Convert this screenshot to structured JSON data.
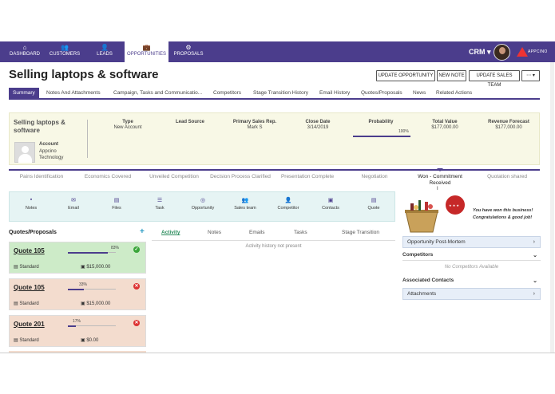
{
  "nav": {
    "items": [
      {
        "icon": "home-icon",
        "glyph": "⌂",
        "label": "DASHBOARD"
      },
      {
        "icon": "customers-icon",
        "glyph": "👥",
        "label": "CUSTOMERS"
      },
      {
        "icon": "leads-icon",
        "glyph": "👤",
        "label": "LEADS"
      },
      {
        "icon": "briefcase-icon",
        "glyph": "💼",
        "label": "OPPORTUNITIES"
      },
      {
        "icon": "proposals-icon",
        "glyph": "⚙",
        "label": "PROPOSALS"
      }
    ],
    "app_switcher": "CRM ▾",
    "logo_text": "APPCINO"
  },
  "page": {
    "title": "Selling laptops & software",
    "buttons": [
      "UPDATE OPPORTUNITY",
      "NEW NOTE",
      "UPDATE SALES TEAM",
      "⋯ ▾"
    ]
  },
  "tabs": [
    "Summary",
    "Notes And Attachments",
    "Campaign, Tasks and Communicatio...",
    "Competitors",
    "Stage Transition History",
    "Email History",
    "Quotes/Proposals",
    "News",
    "Related Actions"
  ],
  "summary": {
    "title": "Selling laptops & software",
    "account_label": "Account",
    "account_name": "Appcino Technology",
    "fields": [
      {
        "label": "Type",
        "value": "New Account"
      },
      {
        "label": "Lead Source",
        "value": ""
      },
      {
        "label": "Primary Sales Rep.",
        "value": "Mark S"
      },
      {
        "label": "Close Date",
        "value": "3/14/2019"
      },
      {
        "label": "Probability",
        "value": ""
      },
      {
        "label": "Total Value",
        "value": "$177,000.00"
      },
      {
        "label": "Revenue Forecast",
        "value": "$177,000.00"
      }
    ],
    "probability_pct": "100%",
    "probability": 1.0
  },
  "stages": [
    "Pains Identification",
    "Economics Covered",
    "Unveiled Competition",
    "Decision Process Clarified",
    "Presentation Complete",
    "Negotiation",
    "Won - Commitment Received",
    "Quotation shared"
  ],
  "actions": [
    {
      "icon": "notes-icon",
      "glyph": "▪",
      "label": "Notes"
    },
    {
      "icon": "email-icon",
      "glyph": "✉",
      "label": "Email"
    },
    {
      "icon": "files-icon",
      "glyph": "▤",
      "label": "Files"
    },
    {
      "icon": "task-icon",
      "glyph": "☰",
      "label": "Task"
    },
    {
      "icon": "opportunity-icon",
      "glyph": "◎",
      "label": "Opportunity"
    },
    {
      "icon": "sales-team-icon",
      "glyph": "👥",
      "label": "Sales team"
    },
    {
      "icon": "competitor-icon",
      "glyph": "👤",
      "label": "Competitor"
    },
    {
      "icon": "contacts-icon",
      "glyph": "▣",
      "label": "Contacts"
    },
    {
      "icon": "quote-icon",
      "glyph": "▤",
      "label": "Quote"
    }
  ],
  "quotes": {
    "title": "Quotes/Proposals",
    "add": "+",
    "items": [
      {
        "name": "Quote 105",
        "pct_label": "83%",
        "progress": 0.83,
        "type": "Standard",
        "amount": "$15,000.00",
        "status": "✓",
        "state": "green"
      },
      {
        "name": "Quote 105",
        "pct_label": "33%",
        "progress": 0.33,
        "type": "Standard",
        "amount": "$15,000.00",
        "status": "✕",
        "state": "red"
      },
      {
        "name": "Quote 201",
        "pct_label": "17%",
        "progress": 0.17,
        "type": "Standard",
        "amount": "$0.00",
        "status": "✕",
        "state": "red"
      }
    ]
  },
  "activity": {
    "tabs": [
      "Activity",
      "Notes",
      "Emails",
      "Tasks",
      "Stage Transition"
    ],
    "empty": "Activity history not present"
  },
  "right": {
    "won_line1": "You have won this business!",
    "won_line2": "Congratulations & good job!",
    "postmortem": "Opportunity Post-Mortem",
    "competitors": "Competitors",
    "no_competitors": "No Competitors Available",
    "contacts": "Associated Contacts",
    "attachments": "Attachments"
  }
}
